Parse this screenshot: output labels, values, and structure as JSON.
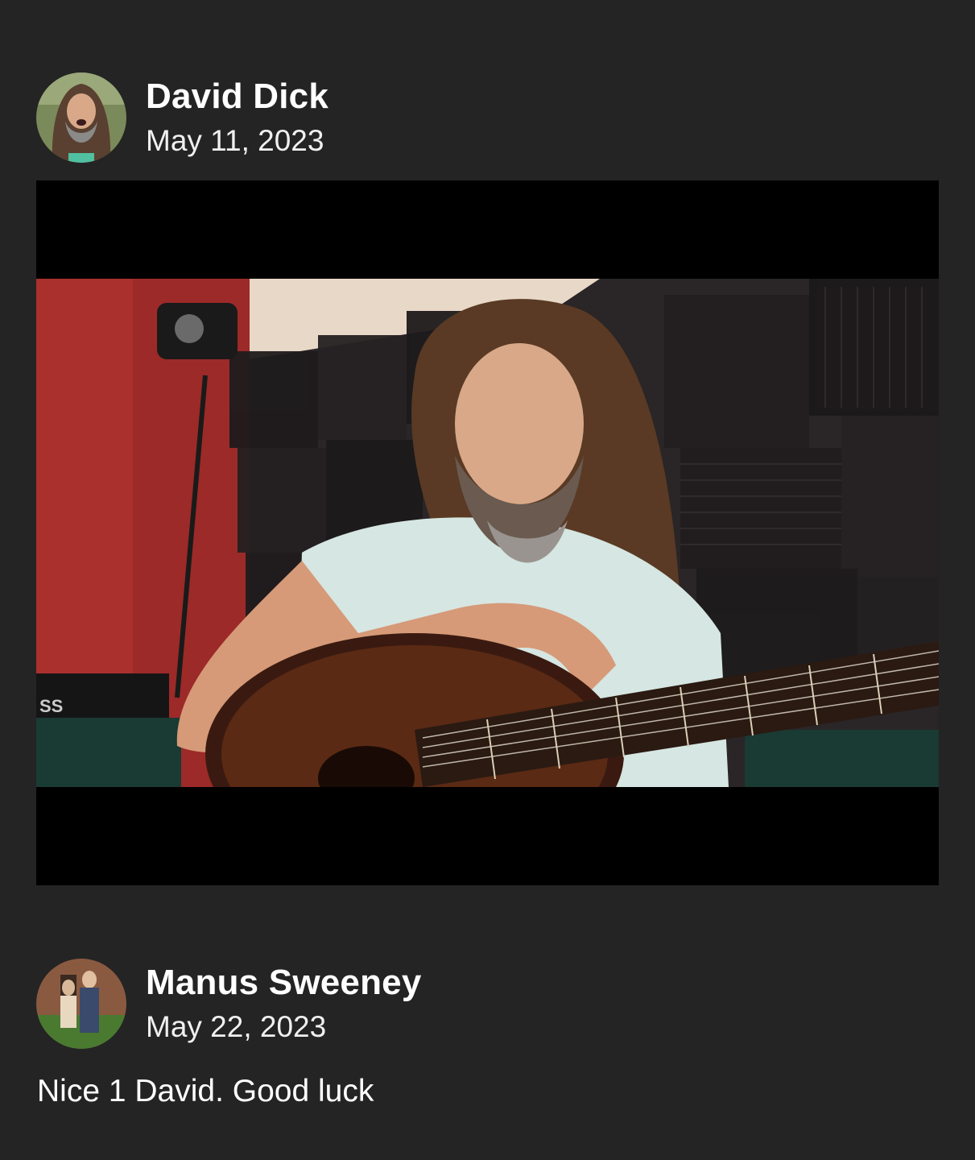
{
  "posts": [
    {
      "author": "David Dick",
      "date": "May 11, 2023",
      "media": "video"
    },
    {
      "author": "Manus Sweeney",
      "date": "May 22, 2023",
      "text": "Nice 1 David. Good luck"
    }
  ],
  "colors": {
    "background": "#242424",
    "text": "#ffffff",
    "video_letterbox": "#000000"
  }
}
